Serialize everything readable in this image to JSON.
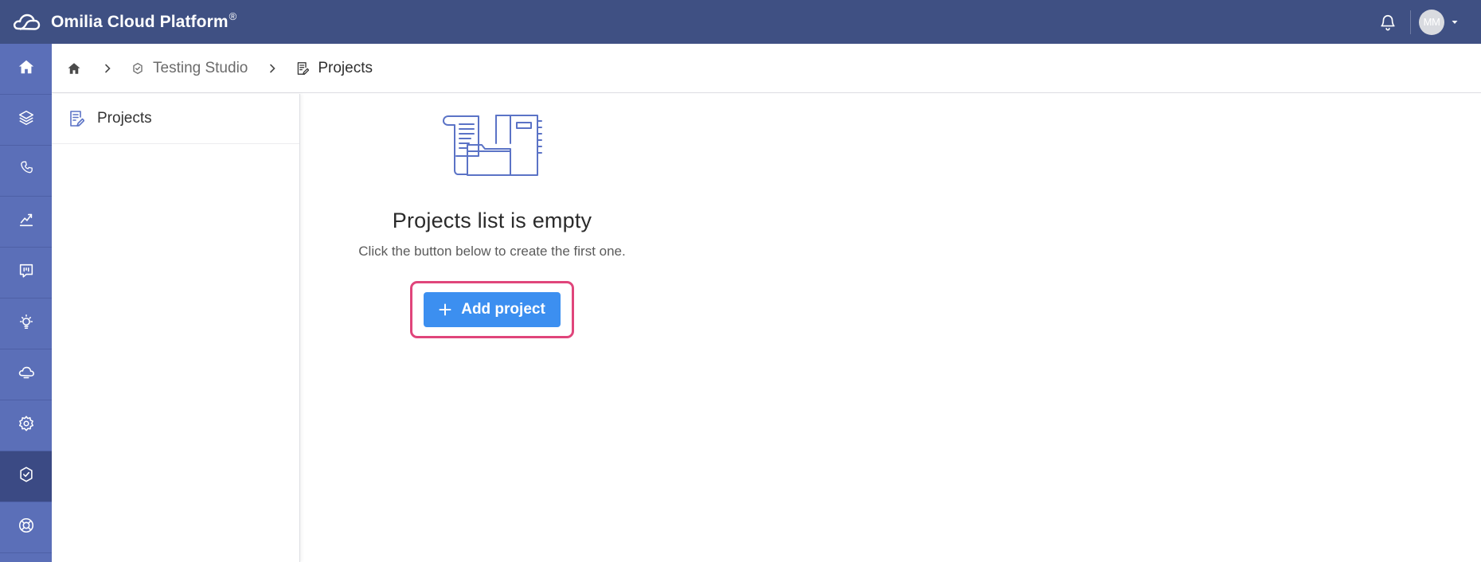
{
  "app": {
    "title": "Omilia Cloud Platform",
    "registered_mark": "®",
    "brand_icon": "cloud-outline-icon"
  },
  "header": {
    "notifications_icon": "bell-icon",
    "user_initials": "MM",
    "user_menu_icon": "caret-down-icon"
  },
  "rail": {
    "items": [
      {
        "name": "home",
        "icon": "home-icon",
        "active": false
      },
      {
        "name": "layers",
        "icon": "layers-icon",
        "active": false
      },
      {
        "name": "phone",
        "icon": "phone-icon",
        "active": false
      },
      {
        "name": "analytics",
        "icon": "chart-icon",
        "active": false
      },
      {
        "name": "feedback",
        "icon": "message-board-icon",
        "active": false
      },
      {
        "name": "insights",
        "icon": "lightbulb-icon",
        "active": false
      },
      {
        "name": "cloud",
        "icon": "cloud-sync-icon",
        "active": false
      },
      {
        "name": "settings",
        "icon": "gear-icon",
        "active": false
      },
      {
        "name": "testing-studio",
        "icon": "badge-check-icon",
        "active": true
      },
      {
        "name": "support",
        "icon": "lifebuoy-icon",
        "active": false
      }
    ]
  },
  "breadcrumb": {
    "home_icon": "home-icon",
    "separator_icon": "chevron-right-icon",
    "section": "Testing Studio",
    "section_icon": "badge-check-icon",
    "current": "Projects",
    "current_icon": "document-edit-icon"
  },
  "sidebar": {
    "items": [
      {
        "label": "Projects",
        "icon": "document-edit-icon"
      }
    ]
  },
  "empty_state": {
    "illustration": "documents-folder-illustration",
    "title": "Projects list is empty",
    "subtitle": "Click the button below to create the first one.",
    "button_label": "Add project",
    "button_icon": "plus-icon"
  },
  "colors": {
    "topbar": "#3f5083",
    "rail": "#5b6fb8",
    "rail_active": "#3b4a84",
    "primary_button": "#3c8ff0",
    "highlight_border": "#e0457b",
    "illustration_stroke": "#5b73c6"
  }
}
